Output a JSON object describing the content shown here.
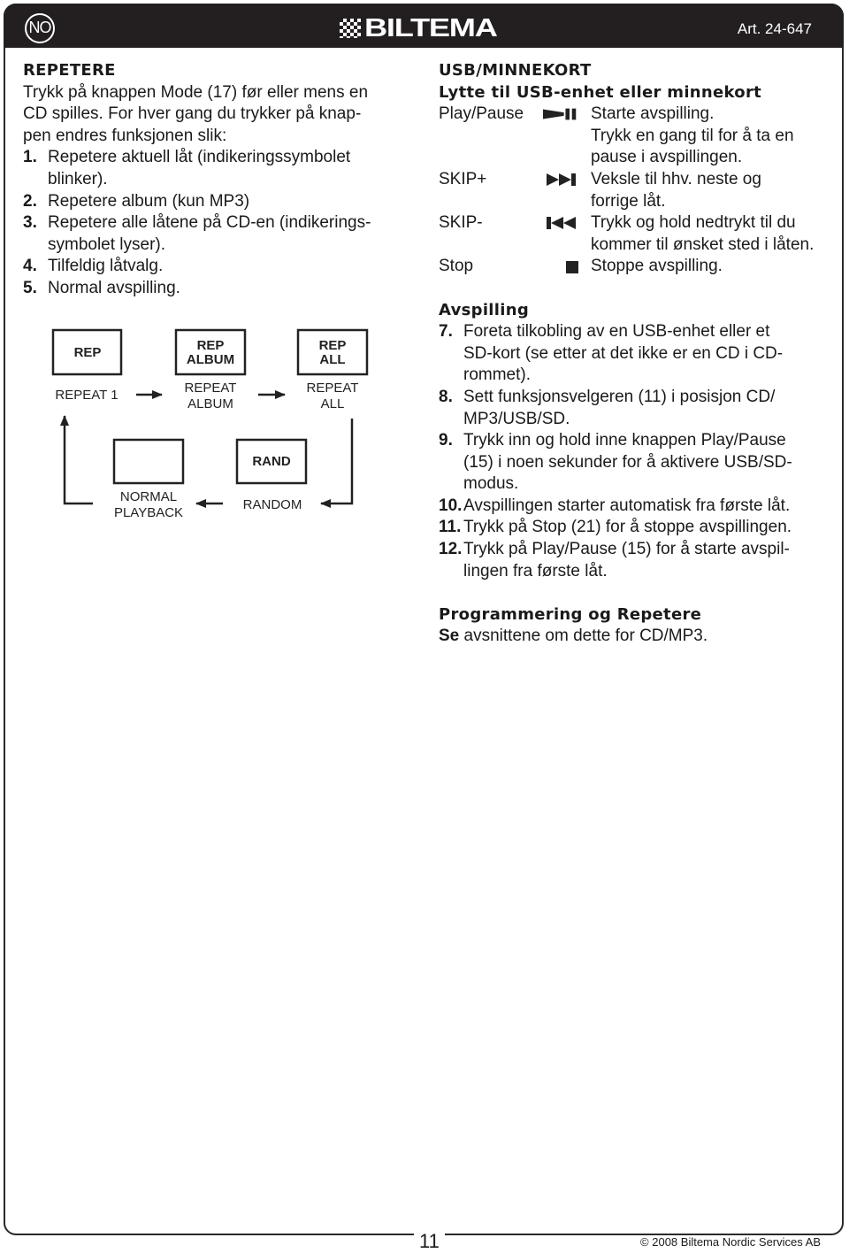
{
  "header": {
    "language_badge": "NO",
    "logo_text": "BILTEMA",
    "article_number": "Art. 24-647"
  },
  "left": {
    "title": "REPETERE",
    "intro": "Trykk på knappen Mode (17) før eller mens en CD spilles. For hver gang du trykker på knap-pen endres funksjonen slik:",
    "intro_lines": [
      "Trykk på knappen Mode (17) før eller mens en",
      "CD spilles. For hver gang du trykker på knap-",
      "pen endres funksjonen slik:"
    ],
    "steps": [
      {
        "num": "1.",
        "lines": [
          "Repetere aktuell låt (indikeringssymbolet",
          "blinker)."
        ]
      },
      {
        "num": "2.",
        "lines": [
          "Repetere album (kun MP3)"
        ]
      },
      {
        "num": "3.",
        "lines": [
          "Repetere alle låtene på CD-en (indikerings-",
          "symbolet lyser)."
        ]
      },
      {
        "num": "4.",
        "lines": [
          "Tilfeldig låtvalg."
        ]
      },
      {
        "num": "5.",
        "lines": [
          "Normal avspilling."
        ]
      }
    ]
  },
  "diagram": {
    "displays": [
      {
        "id": "rep",
        "display": [
          "REP"
        ],
        "caption": [
          "REPEAT 1"
        ]
      },
      {
        "id": "rep-album",
        "display": [
          "REP",
          "ALBUM"
        ],
        "caption": [
          "REPEAT",
          "ALBUM"
        ]
      },
      {
        "id": "rep-all",
        "display": [
          "REP",
          "ALL"
        ],
        "caption": [
          "REPEAT",
          "ALL"
        ]
      },
      {
        "id": "rand",
        "display": [
          "RAND"
        ],
        "caption": [
          "RANDOM"
        ]
      },
      {
        "id": "normal",
        "display": [],
        "caption": [
          "NORMAL",
          "PLAYBACK"
        ]
      }
    ]
  },
  "right": {
    "title": "USB/MINNEKORT",
    "subtitle": "Lytte til USB-enhet eller minnekort",
    "controls": [
      {
        "name": "Play/Pause",
        "icon": "play-pause-icon",
        "lines": [
          "Starte avspilling.",
          "Trykk en gang til for å ta en",
          "pause i avspillingen."
        ]
      },
      {
        "name": "SKIP+",
        "icon": "skip-forward-icon",
        "lines": [
          "Veksle til hhv. neste og",
          "forrige låt."
        ]
      },
      {
        "name": "SKIP-",
        "icon": "skip-back-icon",
        "lines": [
          "Trykk og hold nedtrykt til du",
          "kommer til ønsket sted i låten."
        ]
      },
      {
        "name": "Stop",
        "icon": "stop-icon",
        "lines": [
          "Stoppe avspilling."
        ]
      }
    ],
    "playback_title": "Avspilling",
    "playback_steps": [
      {
        "num": "7.",
        "lines": [
          "Foreta tilkobling av en USB-enhet eller et",
          "SD-kort (se etter at det ikke er en CD i CD-",
          "rommet)."
        ]
      },
      {
        "num": "8.",
        "lines": [
          "Sett funksjonsvelgeren (11) i posisjon CD/",
          "MP3/USB/SD."
        ]
      },
      {
        "num": "9.",
        "lines": [
          "Trykk inn og hold inne knappen Play/Pause",
          "(15) i noen sekunder for å aktivere USB/SD-",
          "modus."
        ]
      },
      {
        "num": "10.",
        "lines": [
          "Avspillingen starter automatisk fra første låt."
        ]
      },
      {
        "num": "11.",
        "lines": [
          "Trykk på Stop (21) for å stoppe avspillingen."
        ]
      },
      {
        "num": "12.",
        "lines": [
          "Trykk på Play/Pause (15) for å starte avspil-",
          "lingen fra første låt."
        ]
      }
    ],
    "programming_title": "Programmering og Repetere",
    "programming_lead": "Se",
    "programming_text": " avsnittene om dette for CD/MP3."
  },
  "footer": {
    "page_number": "11",
    "copyright": "© 2008 Biltema Nordic Services AB"
  }
}
